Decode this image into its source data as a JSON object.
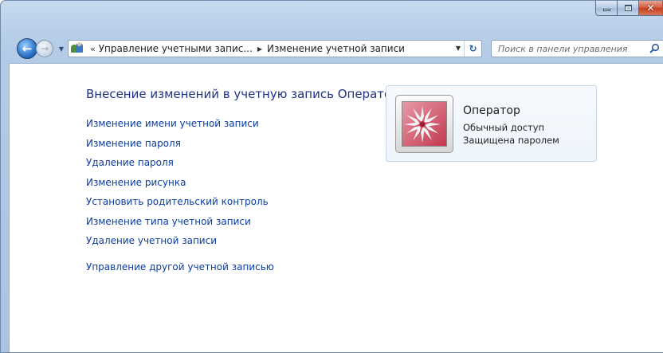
{
  "window": {
    "caption": {
      "minimize": "Свернуть",
      "maximize": "Развернуть",
      "close": "Закрыть"
    }
  },
  "address": {
    "breadcrumbs": [
      "Управление учетными запис...",
      "Изменение учетной записи"
    ],
    "overflow": "«"
  },
  "search": {
    "placeholder": "Поиск в панели управления"
  },
  "content": {
    "title": "Внесение изменений в учетную запись Оператор",
    "tasks": [
      "Изменение имени учетной записи",
      "Изменение пароля",
      "Удаление пароля",
      "Изменение рисунка",
      "Установить родительский контроль",
      "Изменение типа учетной записи",
      "Удаление учетной записи"
    ],
    "other_task": "Управление другой учетной записью"
  },
  "account": {
    "name": "Оператор",
    "type": "Обычный доступ",
    "password_status": "Защищена паролем",
    "picture": "flower-icon"
  },
  "colors": {
    "link": "#0a3da4",
    "title": "#1e3287"
  }
}
